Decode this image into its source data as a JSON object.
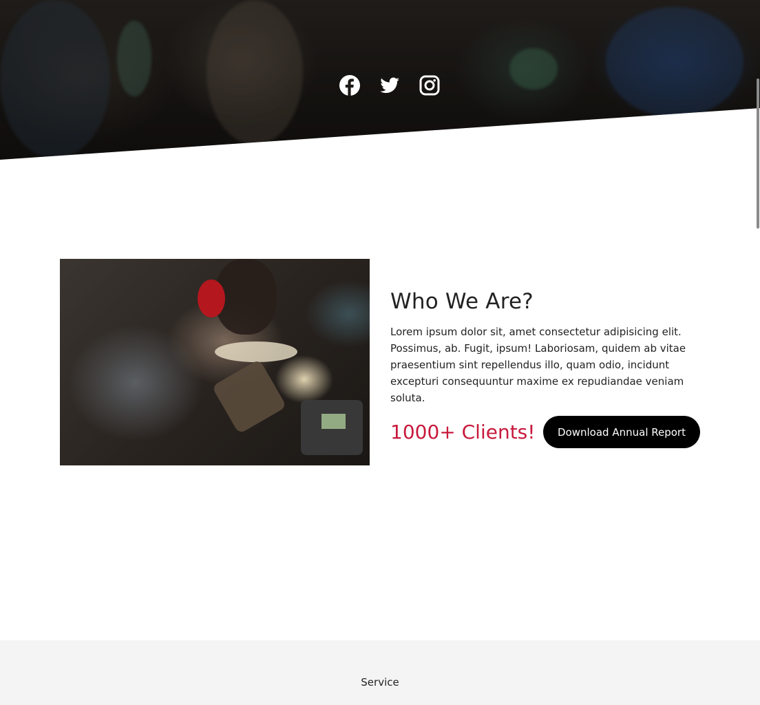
{
  "social": {
    "icons": [
      "facebook-icon",
      "twitter-icon",
      "instagram-icon"
    ],
    "icon_color": "#ffffff"
  },
  "about": {
    "title": "Who We Are?",
    "body": "Lorem ipsum dolor sit, amet consectetur adipisicing elit. Possimus, ab. Fugit, ipsum! Laboriosam, quidem ab vitae praesentium sint repellendus illo, quam odio, incidunt excepturi consequuntur maxime ex repudiandae veniam soluta.",
    "clients": "1000+ Clients!",
    "download_label": "Download Annual Report",
    "accent_color": "#c8193c",
    "button_color": "#000000"
  },
  "service": {
    "title": "Service",
    "band_color": "#f4f4f4"
  }
}
